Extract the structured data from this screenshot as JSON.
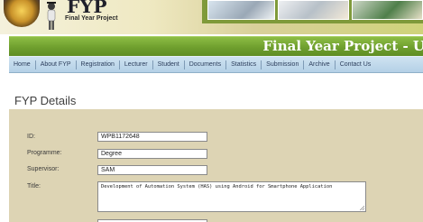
{
  "header": {
    "brand_title": "FYP",
    "brand_subtitle": "Final Year Project",
    "banner_title": "Final Year Project - U"
  },
  "nav": {
    "items": [
      "Home",
      "About FYP",
      "Registration",
      "Lecturer",
      "Student",
      "Documents",
      "Statistics",
      "Submission",
      "Archive",
      "Contact Us"
    ]
  },
  "section": {
    "title": "FYP Details"
  },
  "form": {
    "id_label": "ID:",
    "id_value": "WPB1172648",
    "programme_label": "Programme:",
    "programme_value": "Degree",
    "supervisor_label": "Supervisor:",
    "supervisor_value": "SAM",
    "title_label": "Title:",
    "title_value": "Development of Automation System (HAS) using Android for Smartphone Application"
  }
}
